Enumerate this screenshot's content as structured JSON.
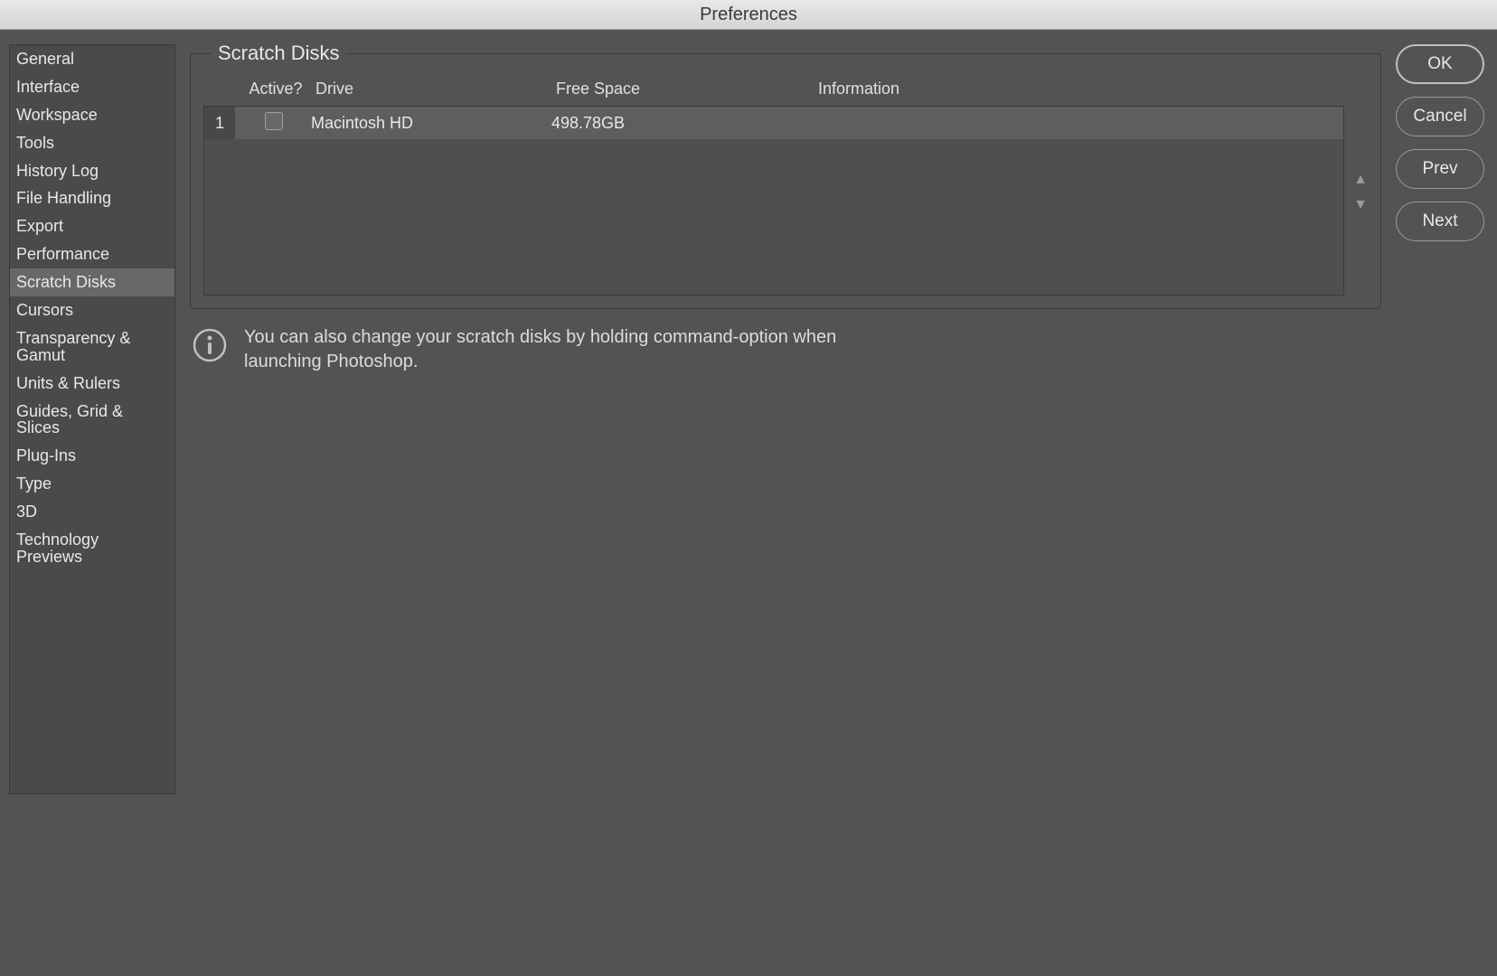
{
  "window": {
    "title": "Preferences"
  },
  "sidebar": {
    "items": [
      {
        "label": "General"
      },
      {
        "label": "Interface"
      },
      {
        "label": "Workspace"
      },
      {
        "label": "Tools"
      },
      {
        "label": "History Log"
      },
      {
        "label": "File Handling"
      },
      {
        "label": "Export"
      },
      {
        "label": "Performance"
      },
      {
        "label": "Scratch Disks"
      },
      {
        "label": "Cursors"
      },
      {
        "label": "Transparency & Gamut"
      },
      {
        "label": "Units & Rulers"
      },
      {
        "label": "Guides, Grid & Slices"
      },
      {
        "label": "Plug-Ins"
      },
      {
        "label": "Type"
      },
      {
        "label": "3D"
      },
      {
        "label": "Technology Previews"
      }
    ],
    "selected_index": 8
  },
  "panel": {
    "title": "Scratch Disks",
    "columns": {
      "active": "Active?",
      "drive": "Drive",
      "free_space": "Free Space",
      "information": "Information"
    },
    "rows": [
      {
        "index": "1",
        "active": false,
        "drive": "Macintosh HD",
        "free_space": "498.78GB",
        "information": ""
      }
    ]
  },
  "hint": {
    "text": "You can also change your scratch disks by holding command-option when launching Photoshop."
  },
  "buttons": {
    "ok": "OK",
    "cancel": "Cancel",
    "prev": "Prev",
    "next": "Next"
  },
  "arrows": {
    "up": "▲",
    "down": "▼"
  }
}
